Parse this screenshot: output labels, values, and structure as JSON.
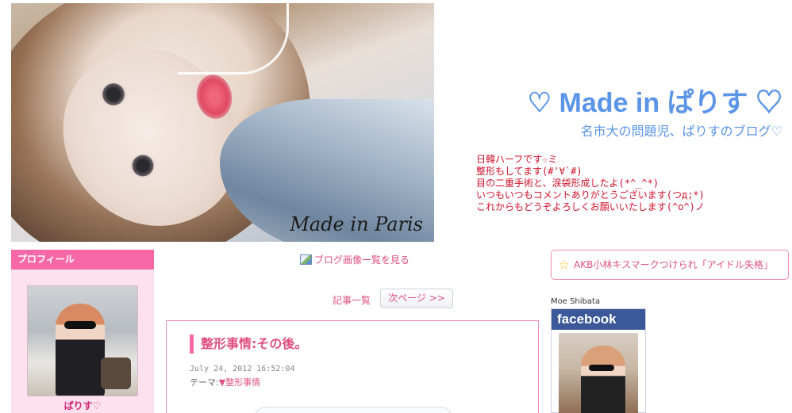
{
  "header": {
    "watermark": "Made in Paris",
    "site_title": "♡ Made in ぱりす ♡",
    "site_subtitle": "名市大の問題児、ぱりすのブログ♡",
    "intro_lines": [
      "日韓ハーフです☆ミ",
      "整形もしてます(#'∀`#)",
      "目の二重手術と、涙袋形成したよ(*^_^*)",
      "いつもいつもコメントありがとうございます(つд;*)",
      "これからもどうぞよろしくお願いいたします(^o^)ノ"
    ]
  },
  "sidebar": {
    "profile_heading": "プロフィール",
    "profile_name": "ぱりす♡"
  },
  "main": {
    "gallery_link": "ブログ画像一覧を見る",
    "entries_link": "記事一覧",
    "next_page": "次ページ >>",
    "entry": {
      "title": "整形事情:その後。",
      "date": "July 24, 2012 16:52:04",
      "theme_label": "テーマ:",
      "theme_value": "▼整形事情"
    }
  },
  "right": {
    "news_banner": "AKB小林キスマークつけられ「アイドル失格」",
    "fb_owner": "Moe Shibata",
    "fb_label": "facebook"
  },
  "colors": {
    "pink_accent": "#f768a7",
    "title_blue": "#5b95e8",
    "intro_red": "#d0102a",
    "facebook_blue": "#3b5998"
  }
}
